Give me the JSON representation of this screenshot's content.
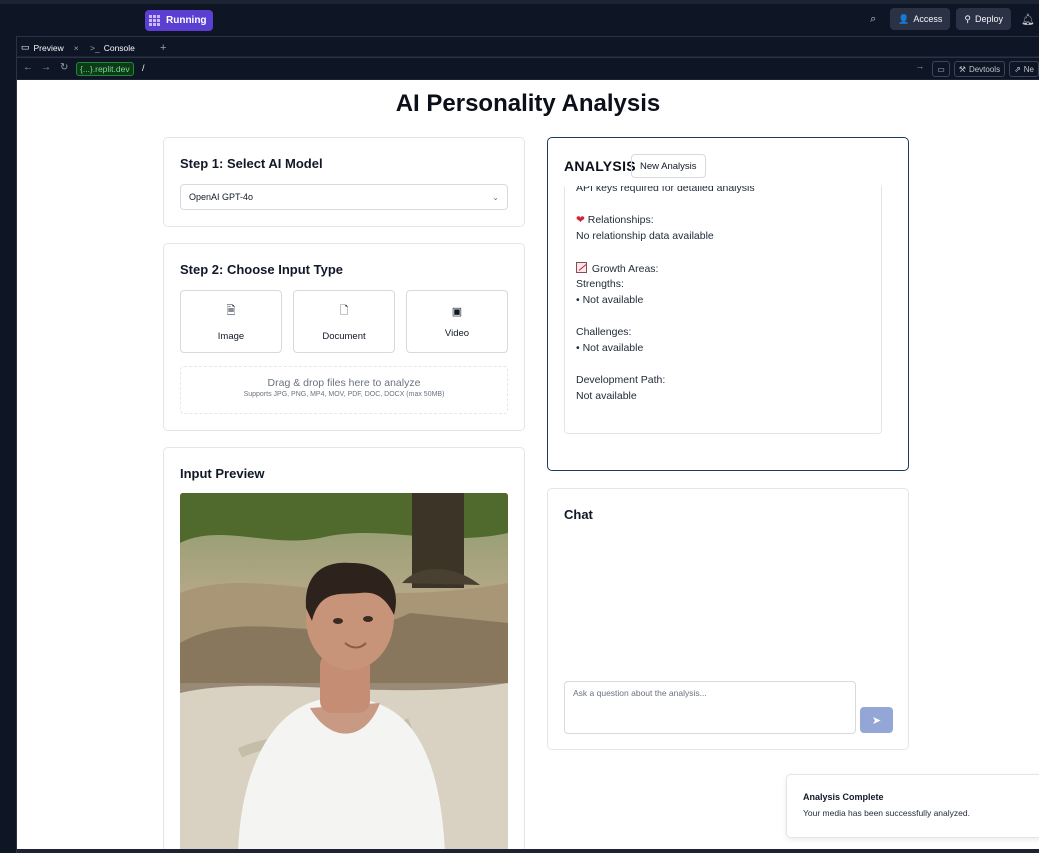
{
  "ide": {
    "status": "Running",
    "access_label": "Access",
    "deploy_label": "Deploy",
    "tabs": [
      {
        "label": "Preview"
      },
      {
        "label": "Console"
      }
    ],
    "url_host": "{...}.replit.dev",
    "url_path": "/",
    "devtools_label": "Devtools",
    "newtab_label": "Ne"
  },
  "page": {
    "title": "AI Personality Analysis"
  },
  "step1": {
    "heading": "Step 1: Select AI Model",
    "selected_model": "OpenAI GPT-4o"
  },
  "step2": {
    "heading": "Step 2: Choose Input Type",
    "types": [
      {
        "label": "Image",
        "icon": "image-file-icon"
      },
      {
        "label": "Document",
        "icon": "document-icon"
      },
      {
        "label": "Video",
        "icon": "film-icon"
      }
    ],
    "drop_text": "Drag & drop files here to analyze",
    "drop_hint": "Supports JPG, PNG, MP4, MOV, PDF, DOC, DOCX (max 50MB)"
  },
  "preview": {
    "heading": "Input Preview"
  },
  "analysis": {
    "heading": "ANALYSIS",
    "new_button": "New Analysis",
    "lines": {
      "api_note": "API keys required for detailed analysis",
      "relationships_h": "Relationships:",
      "relationships_v": "No relationship data available",
      "growth_h": "Growth Areas:",
      "strengths_h": "Strengths:",
      "strengths_v": "• Not available",
      "challenges_h": "Challenges:",
      "challenges_v": "• Not available",
      "devpath_h": "Development Path:",
      "devpath_v": "Not available"
    }
  },
  "chat": {
    "heading": "Chat",
    "placeholder": "Ask a question about the analysis..."
  },
  "toast": {
    "title": "Analysis Complete",
    "message": "Your media has been successfully analyzed."
  }
}
